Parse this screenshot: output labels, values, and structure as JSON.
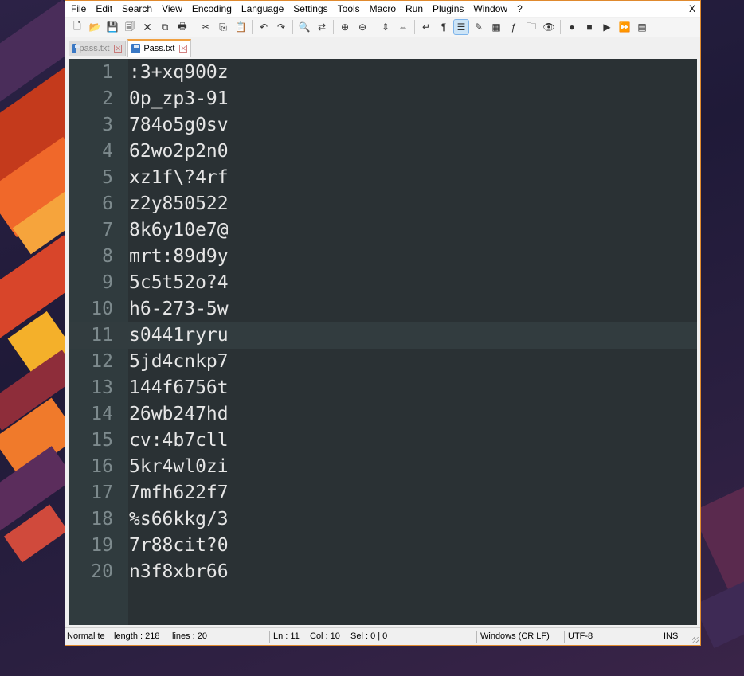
{
  "menu": [
    "File",
    "Edit",
    "Search",
    "View",
    "Encoding",
    "Language",
    "Settings",
    "Tools",
    "Macro",
    "Run",
    "Plugins",
    "Window",
    "?"
  ],
  "window_close": "X",
  "toolbar": [
    {
      "name": "new-file-icon",
      "glyph": "🗋"
    },
    {
      "name": "open-file-icon",
      "glyph": "📂"
    },
    {
      "name": "save-icon",
      "glyph": "💾"
    },
    {
      "name": "save-all-icon",
      "glyph": "🗐"
    },
    {
      "name": "close-icon",
      "glyph": "🗙"
    },
    {
      "name": "close-all-icon",
      "glyph": "⧉"
    },
    {
      "name": "print-icon",
      "glyph": "🖶"
    },
    {
      "sep": true
    },
    {
      "name": "cut-icon",
      "glyph": "✂"
    },
    {
      "name": "copy-icon",
      "glyph": "⎘"
    },
    {
      "name": "paste-icon",
      "glyph": "📋"
    },
    {
      "sep": true
    },
    {
      "name": "undo-icon",
      "glyph": "↶"
    },
    {
      "name": "redo-icon",
      "glyph": "↷"
    },
    {
      "sep": true
    },
    {
      "name": "find-icon",
      "glyph": "🔍"
    },
    {
      "name": "replace-icon",
      "glyph": "⇄"
    },
    {
      "sep": true
    },
    {
      "name": "zoom-in-icon",
      "glyph": "⊕"
    },
    {
      "name": "zoom-out-icon",
      "glyph": "⊖"
    },
    {
      "sep": true
    },
    {
      "name": "sync-vertical-icon",
      "glyph": "⇕"
    },
    {
      "name": "sync-horizontal-icon",
      "glyph": "⇔"
    },
    {
      "sep": true
    },
    {
      "name": "word-wrap-icon",
      "glyph": "↵"
    },
    {
      "name": "show-all-chars-icon",
      "glyph": "¶"
    },
    {
      "name": "indent-guide-icon",
      "glyph": "☰",
      "active": true
    },
    {
      "name": "user-language-icon",
      "glyph": "✎"
    },
    {
      "name": "doc-map-icon",
      "glyph": "▦"
    },
    {
      "name": "function-list-icon",
      "glyph": "ƒ"
    },
    {
      "name": "folder-workspace-icon",
      "glyph": "🗀"
    },
    {
      "name": "monitoring-icon",
      "glyph": "👁"
    },
    {
      "sep": true
    },
    {
      "name": "record-macro-icon",
      "glyph": "●"
    },
    {
      "name": "stop-macro-icon",
      "glyph": "■"
    },
    {
      "name": "play-macro-icon",
      "glyph": "▶"
    },
    {
      "name": "run-macro-multiple-icon",
      "glyph": "⏩"
    },
    {
      "name": "save-macro-icon",
      "glyph": "▤"
    }
  ],
  "tabs": [
    {
      "label": "pass.txt",
      "active": false
    },
    {
      "label": "Pass.txt",
      "active": true
    }
  ],
  "editor": {
    "current_line": 11,
    "lines": [
      ":3+xq900z",
      "0p_zp3-91",
      "784o5g0sv",
      "62wo2p2n0",
      "xz1f\\?4rf",
      "z2y850522",
      "8k6y10e7@",
      "mrt:89d9y",
      "5c5t52o?4",
      "h6-273-5w",
      "s0441ryru",
      "5jd4cnkp7",
      "144f6756t",
      "26wb247hd",
      "cv:4b7cll",
      "5kr4wl0zi",
      "7mfh622f7",
      "%s66kkg/3",
      "7r88cit?0",
      "n3f8xbr66"
    ]
  },
  "status": {
    "file_type": "Normal te",
    "length": "length : 218",
    "lines": "lines : 20",
    "ln": "Ln : 11",
    "col": "Col : 10",
    "sel": "Sel : 0 | 0",
    "eol": "Windows (CR LF)",
    "encoding": "UTF-8",
    "mode": "INS"
  }
}
